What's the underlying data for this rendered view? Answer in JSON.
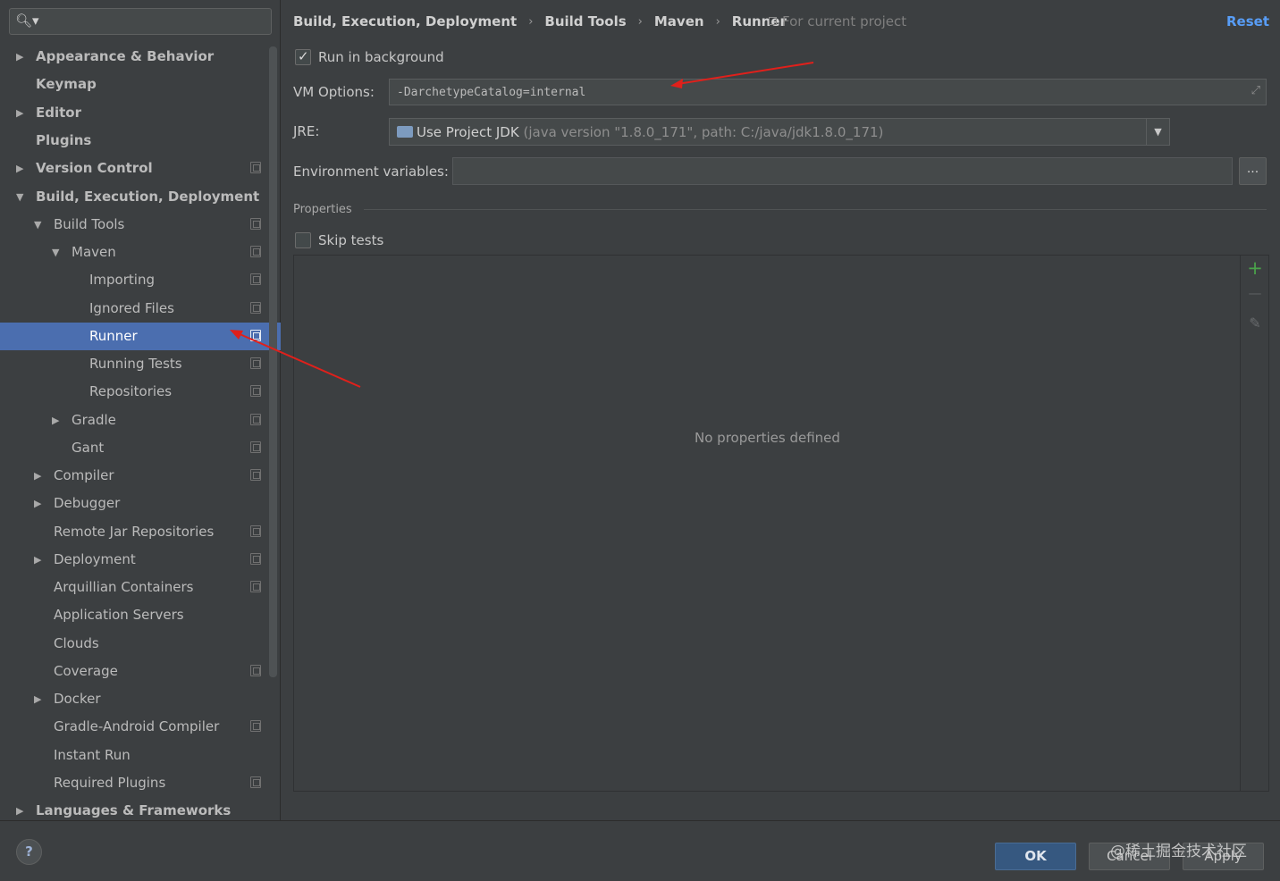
{
  "search": {
    "placeholder": "",
    "value": "",
    "icon": "search-icon"
  },
  "tree": [
    {
      "label": "Appearance & Behavior",
      "expandable": true,
      "expanded": false,
      "bold": true,
      "project_icon": false
    },
    {
      "label": "Keymap",
      "expandable": false,
      "bold": true,
      "project_icon": false
    },
    {
      "label": "Editor",
      "expandable": true,
      "expanded": false,
      "bold": true,
      "project_icon": false
    },
    {
      "label": "Plugins",
      "expandable": false,
      "bold": true,
      "project_icon": false
    },
    {
      "label": "Version Control",
      "expandable": true,
      "expanded": false,
      "bold": true,
      "project_icon": true
    },
    {
      "label": "Build, Execution, Deployment",
      "expandable": true,
      "expanded": true,
      "bold": true,
      "project_icon": false
    },
    {
      "label": "Build Tools",
      "expandable": true,
      "expanded": true,
      "bold": false,
      "project_icon": true
    },
    {
      "label": "Maven",
      "expandable": true,
      "expanded": true,
      "bold": false,
      "project_icon": true
    },
    {
      "label": "Importing",
      "expandable": false,
      "bold": false,
      "project_icon": true
    },
    {
      "label": "Ignored Files",
      "expandable": false,
      "bold": false,
      "project_icon": true
    },
    {
      "label": "Runner",
      "expandable": false,
      "bold": false,
      "project_icon": true,
      "selected": true
    },
    {
      "label": "Running Tests",
      "expandable": false,
      "bold": false,
      "project_icon": true
    },
    {
      "label": "Repositories",
      "expandable": false,
      "bold": false,
      "project_icon": true
    },
    {
      "label": "Gradle",
      "expandable": true,
      "expanded": false,
      "bold": false,
      "project_icon": true
    },
    {
      "label": "Gant",
      "expandable": false,
      "bold": false,
      "project_icon": true
    },
    {
      "label": "Compiler",
      "expandable": true,
      "expanded": false,
      "bold": false,
      "project_icon": true
    },
    {
      "label": "Debugger",
      "expandable": true,
      "expanded": false,
      "bold": false,
      "project_icon": false
    },
    {
      "label": "Remote Jar Repositories",
      "expandable": false,
      "bold": false,
      "project_icon": true
    },
    {
      "label": "Deployment",
      "expandable": true,
      "expanded": false,
      "bold": false,
      "project_icon": true
    },
    {
      "label": "Arquillian Containers",
      "expandable": false,
      "bold": false,
      "project_icon": true
    },
    {
      "label": "Application Servers",
      "expandable": false,
      "bold": false,
      "project_icon": false
    },
    {
      "label": "Clouds",
      "expandable": false,
      "bold": false,
      "project_icon": false
    },
    {
      "label": "Coverage",
      "expandable": false,
      "bold": false,
      "project_icon": true
    },
    {
      "label": "Docker",
      "expandable": true,
      "expanded": false,
      "bold": false,
      "project_icon": false
    },
    {
      "label": "Gradle-Android Compiler",
      "expandable": false,
      "bold": false,
      "project_icon": true
    },
    {
      "label": "Instant Run",
      "expandable": false,
      "bold": false,
      "project_icon": false
    },
    {
      "label": "Required Plugins",
      "expandable": false,
      "bold": false,
      "project_icon": true
    },
    {
      "label": "Languages & Frameworks",
      "expandable": true,
      "expanded": false,
      "bold": true,
      "project_icon": false
    }
  ],
  "breadcrumb": [
    "Build, Execution, Deployment",
    "Build Tools",
    "Maven",
    "Runner"
  ],
  "scope_label": "For current project",
  "reset_label": "Reset",
  "run_in_background": {
    "label": "Run in background",
    "checked": true
  },
  "vm_options": {
    "label": "VM Options:",
    "value": "-DarchetypeCatalog=internal"
  },
  "jre": {
    "label": "JRE:",
    "main": "Use Project JDK",
    "detail": "(java version \"1.8.0_171\", path: C:/java/jdk1.8.0_171)"
  },
  "env_vars": {
    "label": "Environment variables:",
    "value": "",
    "button": "..."
  },
  "properties": {
    "title": "Properties",
    "skip_tests": {
      "label": "Skip tests",
      "checked": false
    },
    "empty_text": "No properties defined",
    "toolbar": {
      "add": "+",
      "remove": "—",
      "edit": "✎"
    }
  },
  "buttons": {
    "help": "?",
    "ok": "OK",
    "cancel": "Cancel",
    "apply": "Apply"
  },
  "watermark": "@稀土掘金技术社区",
  "colors": {
    "selection": "#4b6eaf",
    "link": "#589df6",
    "ok_button": "#365880",
    "annotation_arrow": "#e0201b"
  }
}
